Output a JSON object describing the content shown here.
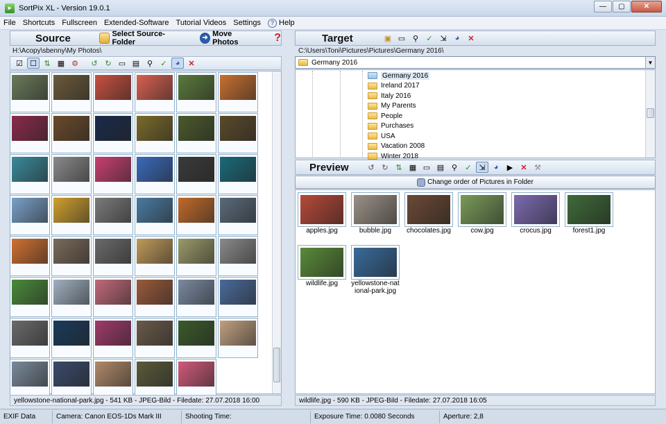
{
  "window": {
    "title": "SortPix XL - Version 19.0.1"
  },
  "menu": [
    "File",
    "Shortcuts",
    "Fullscreen",
    "Extended-Software",
    "Tutorial Videos",
    "Settings",
    "Help"
  ],
  "source": {
    "title": "Source",
    "select_folder_label": "Select Source-Folder",
    "move_photos_label": "Move Photos",
    "path": "H:\\Acopy\\sbenny\\My Photos\\",
    "status": "yellowstone-national-park.jpg - 541 KB - JPEG-Bild - Filedate: 27.07.2018 16:00"
  },
  "target": {
    "title": "Target",
    "path": "C:\\Users\\Toni\\Pictures\\Pictures\\Germany 2016\\",
    "combo_value": "Germany 2016",
    "folders": [
      "Germany 2016",
      "Ireland 2017",
      "Italy 2016",
      "My Parents",
      "People",
      "Purchases",
      "USA",
      "Vacation 2008",
      "Winter 2018"
    ]
  },
  "preview": {
    "title": "Preview",
    "change_order_label": "Change order of Pictures in Folder",
    "photos": [
      {
        "name": "apples.jpg",
        "color": "#b54a3a"
      },
      {
        "name": "bubble.jpg",
        "color": "#9a9187"
      },
      {
        "name": "chocolates.jpg",
        "color": "#6b4a35"
      },
      {
        "name": "cow.jpg",
        "color": "#7a9a5a"
      },
      {
        "name": "crocus.jpg",
        "color": "#7c6bb0"
      },
      {
        "name": "forest1.jpg",
        "color": "#3f6a3a"
      },
      {
        "name": "wildlife.jpg",
        "color": "#5a8a3a"
      },
      {
        "name": "yellowstone-national-park.jpg",
        "color": "#3a6a9a"
      }
    ],
    "status": "wildlife.jpg - 590 KB - JPEG-Bild - Filedate: 27.07.2018 16:05"
  },
  "bottom": {
    "exif": "EXIF Data",
    "camera": "Camera: Canon EOS-1Ds Mark III",
    "shooting": "Shooting Time:",
    "exposure": "Exposure Time: 0.0080 Seconds",
    "aperture": "Aperture: 2,8"
  },
  "thumb_colors": [
    "#6a7a5a",
    "#6b5a3a",
    "#c85040",
    "#d86050",
    "#5a7a3a",
    "#c87030",
    "#8a2a4a",
    "#6a4a2a",
    "#1a2a4a",
    "#7a6a2a",
    "#4a5a2a",
    "#5a4a2a",
    "#3a8a9a",
    "#8a8a8a",
    "#c84070",
    "#3a6aba",
    "#3a3a3a",
    "#1a6a7a",
    "#7aa0c8",
    "#d0a030",
    "#7a7a7a",
    "#4a7aa0",
    "#c06a2a",
    "#5a6a7a",
    "#d07030",
    "#7a6a5a",
    "#6a6a6a",
    "#c09a5a",
    "#9a9a6a",
    "#8a8a8a",
    "#4a8a3a",
    "#a0b0c0",
    "#c06a7a",
    "#9a5a3a",
    "#7a8aa0",
    "#4a6a9a",
    "#6a6a6a",
    "#1a3a5a",
    "#a03a6a",
    "#6a5a4a",
    "#3a5a2a",
    "#c0a080",
    "#7a8a9a",
    "#3a4a6a",
    "#b08a6a",
    "#5a5a3a",
    "#d05a7a"
  ]
}
